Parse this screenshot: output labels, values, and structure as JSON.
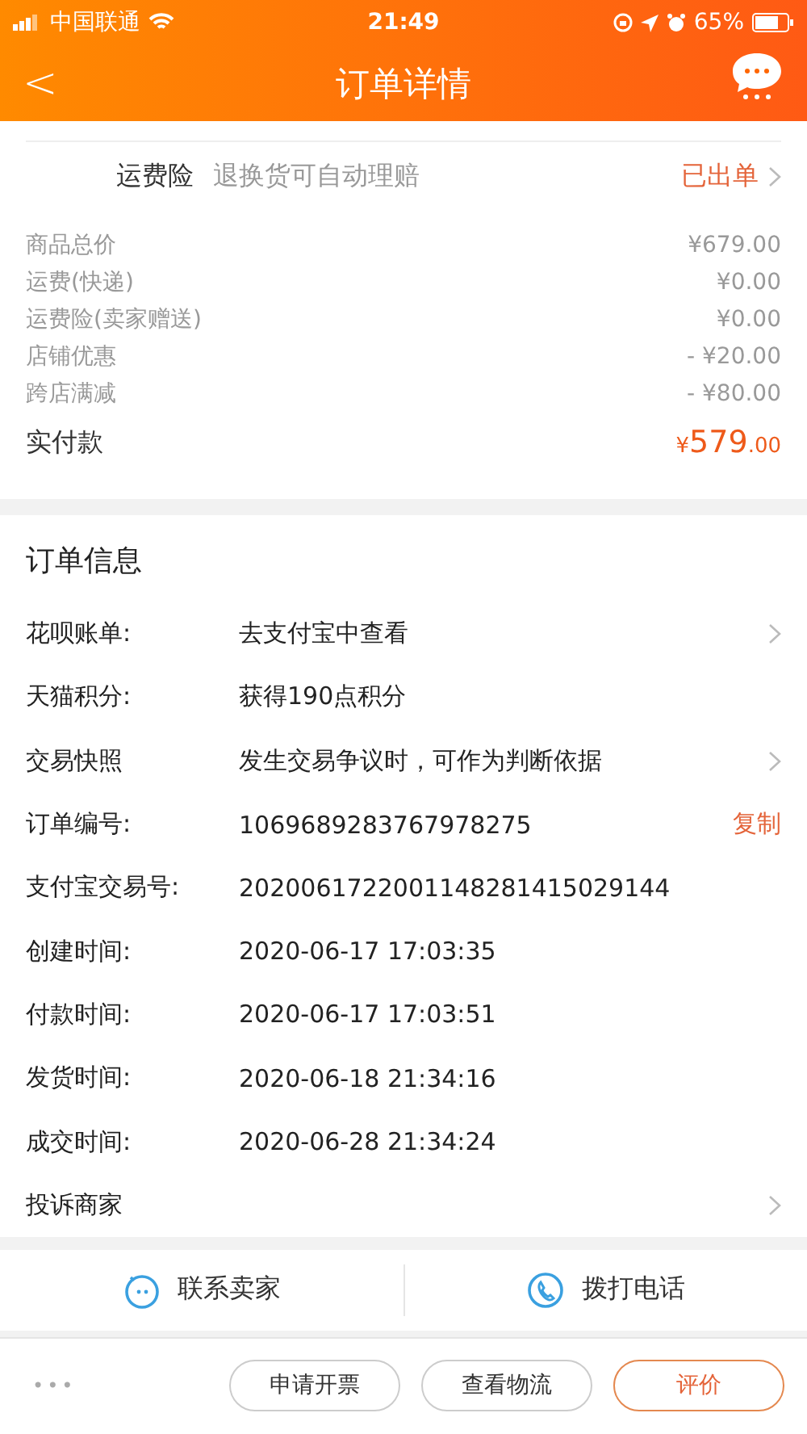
{
  "status_bar": {
    "carrier": "中国联通",
    "time": "21:49",
    "battery": "65%"
  },
  "header": {
    "back": "<",
    "title": "订单详情"
  },
  "insurance": {
    "label": "运费险",
    "desc": "退换货可自动理赔",
    "status": "已出单"
  },
  "prices": [
    {
      "label": "商品总价",
      "value": "¥679.00"
    },
    {
      "label": "运费(快递)",
      "value": "¥0.00"
    },
    {
      "label": "运费险(卖家赠送)",
      "value": "¥0.00"
    },
    {
      "label": "店铺优惠",
      "value": "- ¥20.00"
    },
    {
      "label": "跨店满减",
      "value": "- ¥80.00"
    }
  ],
  "total": {
    "label": "实付款",
    "currency": "¥",
    "amount": "579",
    "cents": ".00"
  },
  "order_info": {
    "title": "订单信息",
    "rows": [
      {
        "kind": "link",
        "label": "花呗账单:",
        "value": "去支付宝中查看"
      },
      {
        "kind": "plain",
        "label": "天猫积分:",
        "value": "获得190点积分"
      },
      {
        "kind": "link",
        "label": "交易快照",
        "value": "发生交易争议时，可作为判断依据"
      },
      {
        "kind": "copy",
        "label": "订单编号:",
        "value": "1069689283767978275",
        "action": "复制"
      },
      {
        "kind": "plain",
        "label": "支付宝交易号:",
        "value": "2020061722001148281415029144"
      },
      {
        "kind": "plain",
        "label": "创建时间:",
        "value": "2020-06-17 17:03:35"
      },
      {
        "kind": "plain",
        "label": "付款时间:",
        "value": "2020-06-17 17:03:51"
      },
      {
        "kind": "plain",
        "label": "发货时间:",
        "value": "2020-06-18 21:34:16"
      },
      {
        "kind": "plain",
        "label": "成交时间:",
        "value": "2020-06-28 21:34:24"
      },
      {
        "kind": "link",
        "label": "投诉商家"
      }
    ]
  },
  "contact": [
    {
      "kind": "chat",
      "label": "联系卖家"
    },
    {
      "kind": "phone",
      "label": "拨打电话"
    }
  ],
  "bottom_bar": {
    "more": "•••",
    "buttons": [
      {
        "label": "申请开票",
        "primary": false
      },
      {
        "label": "查看物流",
        "primary": false
      },
      {
        "label": "评价",
        "primary": true
      }
    ]
  }
}
